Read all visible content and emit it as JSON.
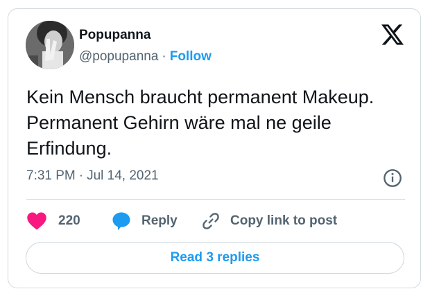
{
  "tweet": {
    "author": {
      "display_name": "Popupanna",
      "handle": "@popupanna",
      "separator": "·",
      "follow_label": "Follow",
      "avatar_icon": "profile-photo"
    },
    "platform_icon": "x-logo-icon",
    "text": "Kein Mensch braucht permanent Makeup. Permanent Gehirn wäre mal ne geile Erfindung.",
    "timestamp": {
      "time": "7:31 PM",
      "separator": "·",
      "date": "Jul 14, 2021"
    },
    "info_icon": "info-icon",
    "actions": {
      "like": {
        "icon": "heart-icon",
        "count": "220",
        "color": "#f91880"
      },
      "reply": {
        "icon": "reply-bubble-icon",
        "label": "Reply",
        "color": "#1d9bf0"
      },
      "copy_link": {
        "icon": "link-icon",
        "label": "Copy link to post"
      }
    },
    "read_replies_label": "Read 3 replies"
  },
  "colors": {
    "accent": "#1d9bf0",
    "text_primary": "#0f1419",
    "text_secondary": "#536471",
    "border": "#cfd9de",
    "like": "#f91880"
  }
}
